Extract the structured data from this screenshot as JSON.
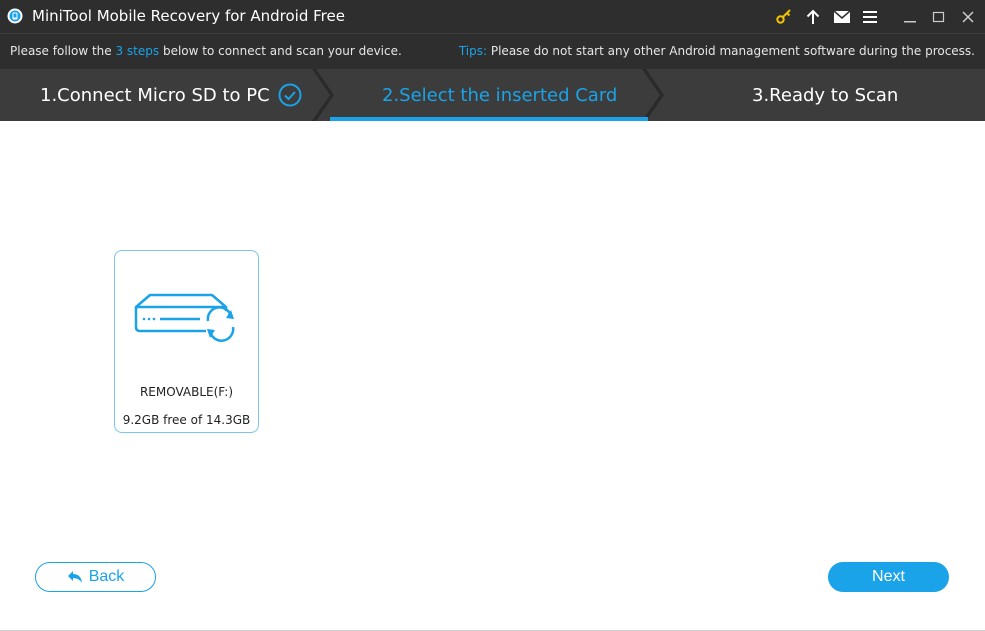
{
  "window": {
    "title": "MiniTool Mobile Recovery for Android Free",
    "icons": [
      "key-icon",
      "upgrade-arrow-icon",
      "mail-icon",
      "menu-icon",
      "minimize-icon",
      "maximize-icon",
      "close-icon"
    ]
  },
  "infobar": {
    "instruction_prefix": "Please follow the ",
    "instruction_highlight": "3 steps",
    "instruction_suffix": " below to connect and scan your device.",
    "tips_label": "Tips:",
    "tips_text": " Please do not start any other Android management software during the process."
  },
  "steps": [
    {
      "label": "1.Connect Micro SD to PC",
      "state": "done"
    },
    {
      "label": "2.Select the inserted Card",
      "state": "active"
    },
    {
      "label": "3.Ready to Scan",
      "state": "pending"
    }
  ],
  "drive": {
    "name": "REMOVABLE(F:)",
    "capacity": "9.2GB free of 14.3GB",
    "icon": "removable-drive-icon"
  },
  "buttons": {
    "back_label": "Back",
    "next_label": "Next"
  },
  "colors": {
    "accent": "#1aa3e8",
    "titlebar_bg": "#2e2e2e",
    "steps_bg": "#3c3c3c"
  }
}
